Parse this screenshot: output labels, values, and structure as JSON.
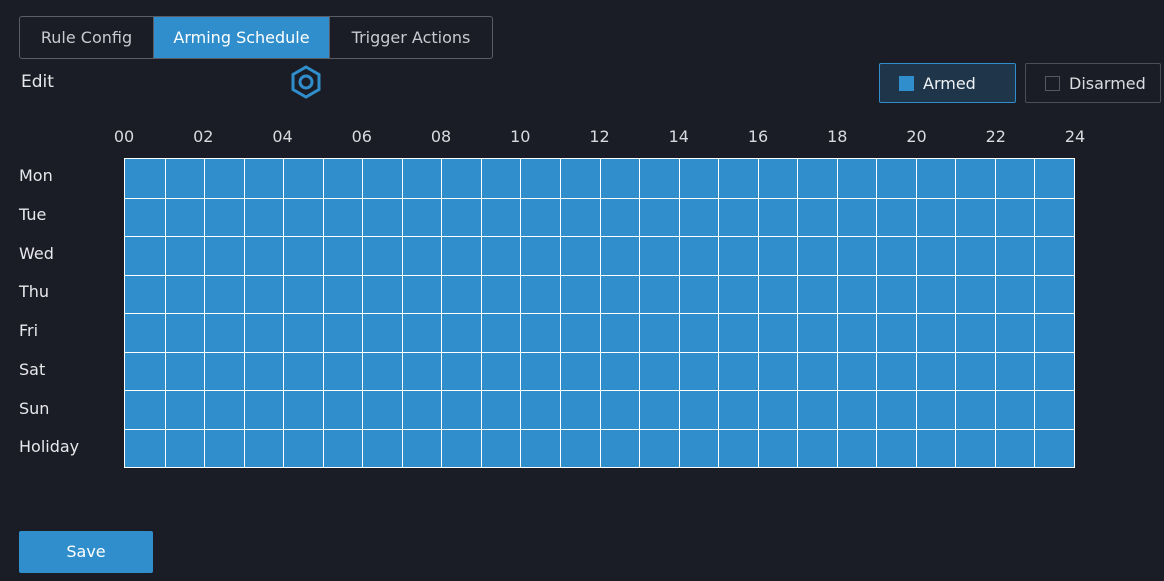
{
  "tabs": [
    {
      "label": "Rule Config",
      "active": false
    },
    {
      "label": "Arming Schedule",
      "active": true
    },
    {
      "label": "Trigger Actions",
      "active": false
    }
  ],
  "edit": {
    "label": "Edit",
    "icon": "hexagon-settings-icon"
  },
  "legend": {
    "armed": {
      "label": "Armed",
      "color": "#2f8ecb",
      "selected": true
    },
    "disarmed": {
      "label": "Disarmed",
      "selected": false
    }
  },
  "hours": [
    "00",
    "02",
    "04",
    "06",
    "08",
    "10",
    "12",
    "14",
    "16",
    "18",
    "20",
    "22",
    "24"
  ],
  "days": [
    "Mon",
    "Tue",
    "Wed",
    "Thu",
    "Fri",
    "Sat",
    "Sun",
    "Holiday"
  ],
  "schedule": {
    "all_armed": true,
    "armed_color": "#2f8ecb",
    "grid_line_color": "#ffffff"
  },
  "save_label": "Save",
  "colors": {
    "background": "#1b1d26",
    "accent": "#2f8ecb"
  }
}
